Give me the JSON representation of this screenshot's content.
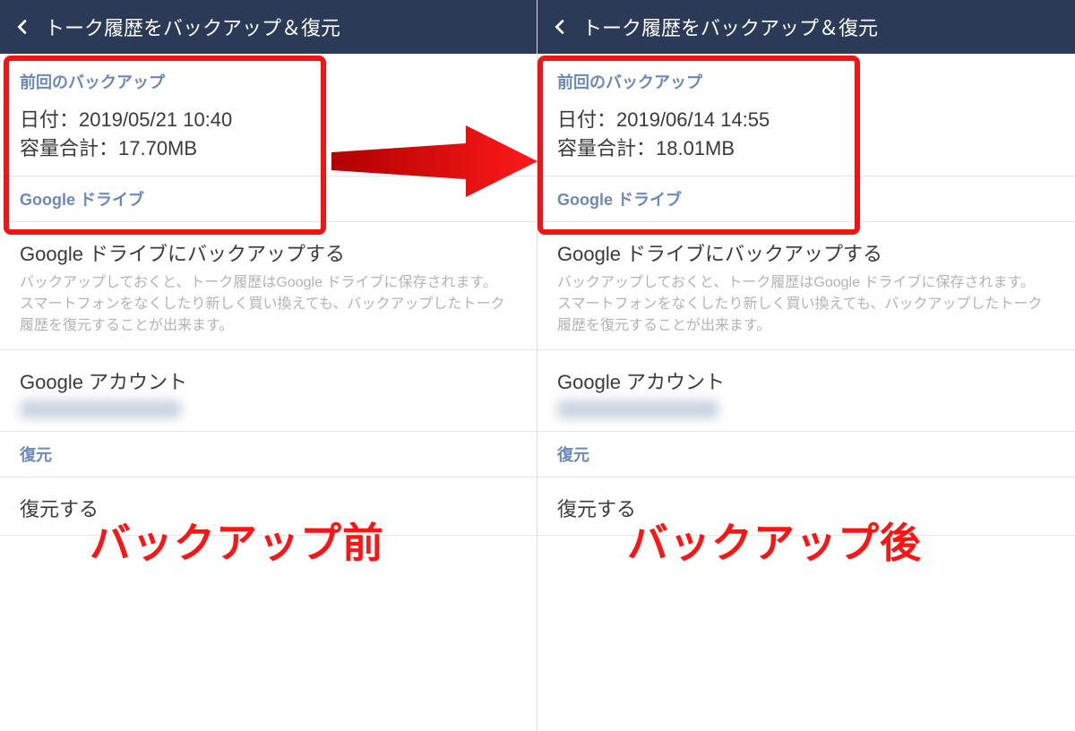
{
  "left": {
    "header_title": "トーク履歴をバックアップ＆復元",
    "last_backup_label": "前回のバックアップ",
    "date_line": "日付：2019/05/21 10:40",
    "size_line": "容量合計：17.70MB",
    "google_drive_label": "Google ドライブ",
    "backup_action": "Google ドライブにバックアップする",
    "backup_desc1": "バックアップしておくと、トーク履歴はGoogle ドライブに保存されます。",
    "backup_desc2": "スマートフォンをなくしたり新しく買い換えても、バックアップしたトーク履歴を復元することが出来ます。",
    "google_account_label": "Google アカウント",
    "restore_label": "復元",
    "restore_action": "復元する",
    "overlay": "バックアップ前"
  },
  "right": {
    "header_title": "トーク履歴をバックアップ＆復元",
    "last_backup_label": "前回のバックアップ",
    "date_line": "日付：2019/06/14 14:55",
    "size_line": "容量合計：18.01MB",
    "google_drive_label": "Google ドライブ",
    "backup_action": "Google ドライブにバックアップする",
    "backup_desc1": "バックアップしておくと、トーク履歴はGoogle ドライブに保存されます。",
    "backup_desc2": "スマートフォンをなくしたり新しく買い換えても、バックアップしたトーク履歴を復元することが出来ます。",
    "google_account_label": "Google アカウント",
    "restore_label": "復元",
    "restore_action": "復元する",
    "overlay": "バックアップ後"
  }
}
